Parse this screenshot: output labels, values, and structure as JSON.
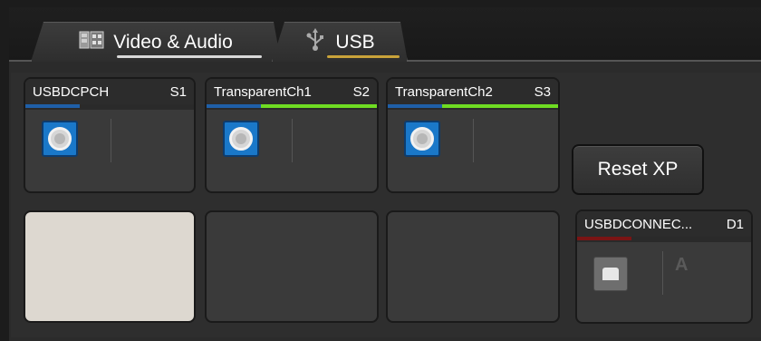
{
  "tabs": [
    {
      "label": "Video & Audio",
      "icon": "video-audio-icon",
      "underline_color": "#d8d8d8"
    },
    {
      "label": "USB",
      "icon": "usb-icon",
      "underline_color": "#c9a33a",
      "active": true
    }
  ],
  "sources": [
    {
      "name": "USBDCPCH",
      "slot": "S1",
      "signal_color": "#1f5fa8",
      "has_link": false
    },
    {
      "name": "TransparentCh1",
      "slot": "S2",
      "signal_color": "#6fdc22",
      "has_link": true
    },
    {
      "name": "TransparentCh2",
      "slot": "S3",
      "signal_color": "#6fdc22",
      "has_link": true
    }
  ],
  "reset_button": {
    "label": "Reset XP"
  },
  "destination": {
    "name": "USBDCONNEC...",
    "slot": "D1",
    "letter": "A",
    "signal_color": "#7a1414"
  },
  "colors": {
    "accent": "#c9a33a",
    "selected_slot": "#ddd8d0",
    "usb_blue": "#1a78c9"
  }
}
